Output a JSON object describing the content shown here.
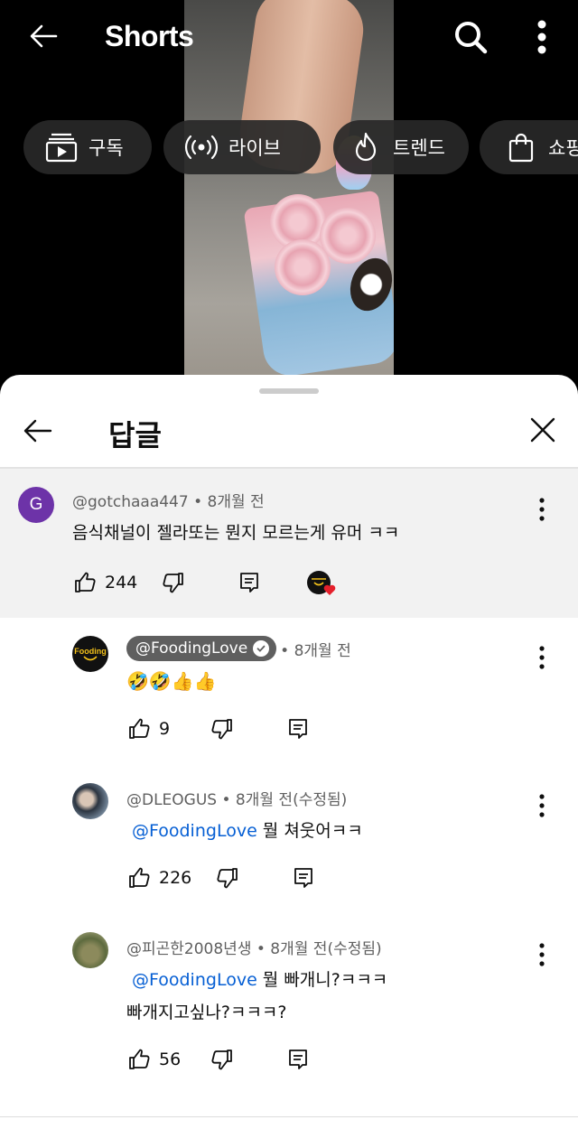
{
  "header": {
    "title": "Shorts",
    "back_icon": "arrow-left-icon",
    "search_icon": "search-icon",
    "more_icon": "more-vertical-icon"
  },
  "chips": [
    {
      "label": "구독",
      "icon": "subscriptions-icon"
    },
    {
      "label": "라이브",
      "icon": "live-icon"
    },
    {
      "label": "트렌드",
      "icon": "trending-icon"
    },
    {
      "label": "쇼핑",
      "icon": "shopping-bag-icon"
    }
  ],
  "sheet": {
    "title": "답글",
    "back_icon": "arrow-left-icon",
    "close_icon": "close-icon"
  },
  "parent_comment": {
    "avatar_letter": "G",
    "author": "@gotchaaa447",
    "time": " • 8개월 전",
    "text": "음식채널이 젤라또는 뭔지 모르는게 유머 ㅋㅋ",
    "likes": "244"
  },
  "replies": [
    {
      "avatar": "channel-logo",
      "avatar_text": "Fooding",
      "author": "@FoodingLove",
      "is_channel_owner": true,
      "time": " • 8개월 전",
      "text": "🤣🤣👍👍",
      "likes": "9"
    },
    {
      "avatar": "photo",
      "author": "@DLEOGUS",
      "time": " • 8개월 전(수정됨)",
      "mention": "@FoodingLove",
      "text": " 뭘 쳐웃어ㅋㅋ",
      "likes": "226"
    },
    {
      "avatar": "photo",
      "author": "@피곤한2008년생",
      "time": " • 8개월 전(수정됨)",
      "mention": "@FoodingLove",
      "text": " 뭘 빠개니?ㅋㅋㅋ",
      "text_line2": "빠개지고싶나?ㅋㅋㅋ?",
      "likes": "56"
    }
  ],
  "colors": {
    "mention": "#065fd4",
    "avatar_g": "#6d33a8",
    "heart": "#e5202b"
  }
}
